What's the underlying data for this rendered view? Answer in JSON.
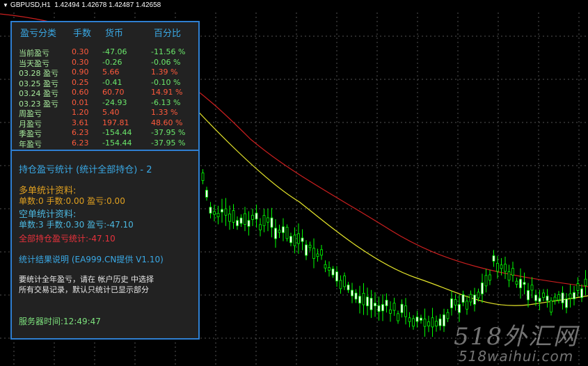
{
  "window": {
    "symbol_timeframe": "GBPUSD,H1",
    "ohlc": "1.42494 1.42678 1.42487 1.42658"
  },
  "stats_table": {
    "headers": [
      "盈亏分类",
      "手数",
      "货币",
      "百分比"
    ],
    "rows": [
      {
        "label": "当前盈亏",
        "lots": "0.30",
        "money": "-47.06",
        "pct": "-11.56 %"
      },
      {
        "label": "当天盈亏",
        "lots": "0.30",
        "money": "-0.26",
        "pct": "-0.06 %"
      },
      {
        "label": "03.28 盈亏",
        "lots": "0.90",
        "money": "5.66",
        "pct": "1.39 %"
      },
      {
        "label": "03.25 盈亏",
        "lots": "0.25",
        "money": "-0.41",
        "pct": "-0.10 %"
      },
      {
        "label": "03.24 盈亏",
        "lots": "0.60",
        "money": "60.70",
        "pct": "14.91 %"
      },
      {
        "label": "03.23 盈亏",
        "lots": "0.01",
        "money": "-24.93",
        "pct": "-6.13 %"
      },
      {
        "label": "周盈亏",
        "lots": "1.20",
        "money": "5.40",
        "pct": "1.33 %"
      },
      {
        "label": "月盈亏",
        "lots": "3.61",
        "money": "197.81",
        "pct": "48.60 %"
      },
      {
        "label": "季盈亏",
        "lots": "6.23",
        "money": "-154.44",
        "pct": "-37.95 %"
      },
      {
        "label": "年盈亏",
        "lots": "6.23",
        "money": "-154.44",
        "pct": "-37.95 %"
      }
    ]
  },
  "holdings": {
    "title": "持仓盈亏统计 (统计全部持仓) - 2",
    "long_title": "多单统计资料:",
    "long_line": "单数:0    手数:0.00    盈亏:0.00",
    "short_title": "空单统计资料:",
    "short_line": "单数:3    手数:0.30    盈亏:-47.10",
    "total_line": "全部持仓盈亏统计:-47.10",
    "desc_title": "统计结果说明  (EA999.CN提供 V1.10)",
    "desc_line1": "要统计全年盈亏，请在 帐户历史 中选择",
    "desc_line2": "所有交易记录，默认只统计已显示部分",
    "server_time": "服务器时间:12:49:47"
  },
  "watermark": {
    "big": "518外汇网",
    "small": "518waihui.com"
  },
  "colors": {
    "bull": "#00ff00",
    "bear": "#ffffff",
    "ma_fast": "#e6e62a",
    "ma_slow": "#cc1f1f",
    "panel_border": "#2f7fd1"
  }
}
